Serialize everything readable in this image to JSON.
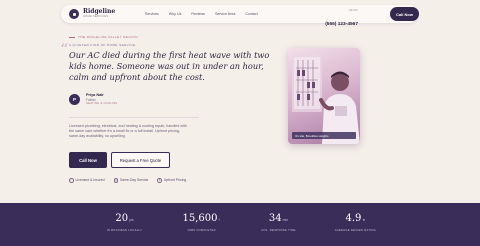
{
  "brand": {
    "name": "Ridgeline",
    "subtitle": "Home Services"
  },
  "nav": {
    "links": [
      "Services",
      "Why Us",
      "Reviews",
      "Service Area",
      "Contact"
    ],
    "phone_label": "Call 24/7",
    "phone": "(555) 123-4567",
    "cta": "Call Now"
  },
  "hero": {
    "eyebrow": "The Ridgeline Valley Region",
    "kicker": "A quieter kind of home service.",
    "quote_mark": "“",
    "headline": "Our AC died during the first heat wave with two kids home. Someone was out in under an hour, calm and upfront about the cost.",
    "author": {
      "initial": "P",
      "name": "Priya Nair",
      "city": "Fairfax",
      "service": "Heating & Cooling"
    },
    "description": "Licensed plumbing, electrical, and heating & cooling repair, handled with the same care whether it's a small fix or a full install. Upfront pricing, same-day availability, no upselling.",
    "primary_cta": "Call Now",
    "secondary_cta": "Request a Free Quote",
    "badges": [
      {
        "icon": "check-icon",
        "label": "Licensed & Insured"
      },
      {
        "icon": "clock-icon",
        "label": "Same-Day Service"
      },
      {
        "icon": "tag-icon",
        "label": "Upfront Pricing"
      }
    ],
    "photo_caption": "On site, Brookline Heights"
  },
  "stats": [
    {
      "value": "20",
      "unit": "yrs",
      "label": "In business locally"
    },
    {
      "value": "15,600",
      "unit": "+",
      "label": "Jobs completed"
    },
    {
      "value": "34",
      "unit": "min",
      "label": "Avg. response time"
    },
    {
      "value": "4.9",
      "unit": "★",
      "label": "Average review rating"
    }
  ],
  "colors": {
    "background": "#f5efea",
    "primary": "#33294f",
    "accent": "#b06a83",
    "stats_band": "#3a2d5a"
  }
}
